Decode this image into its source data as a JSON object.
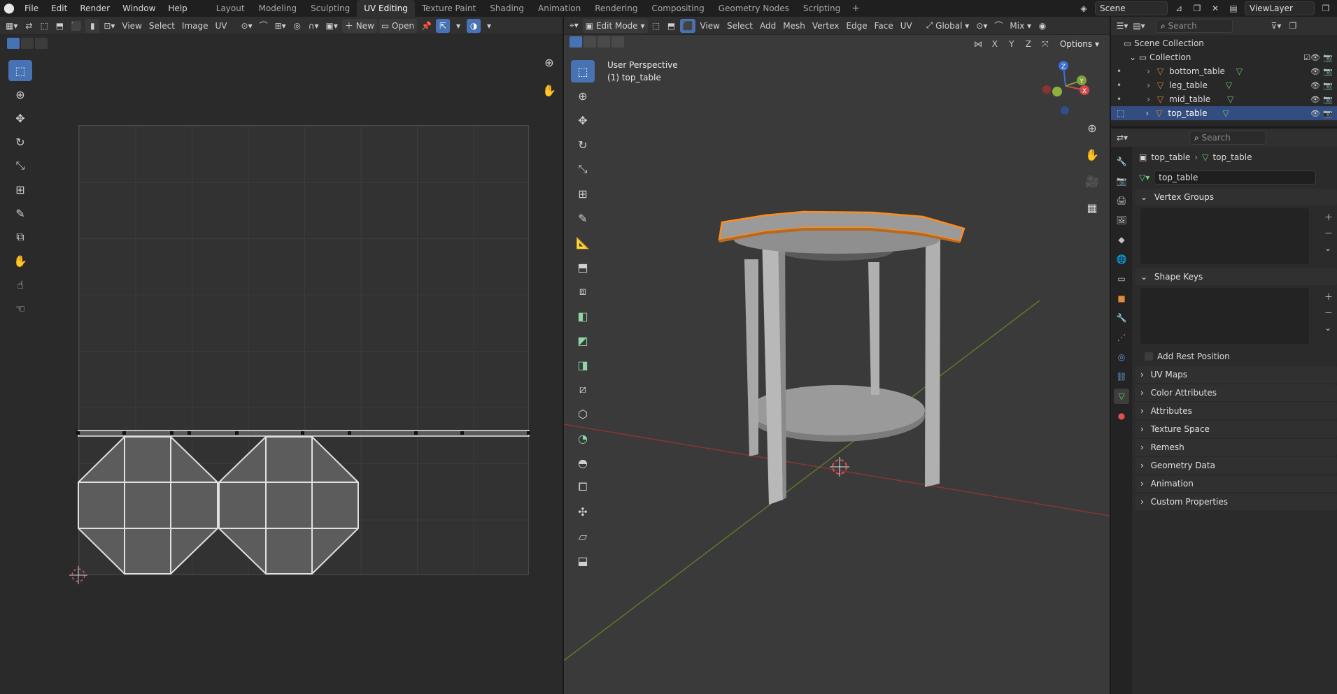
{
  "topbar": {
    "menus": [
      "File",
      "Edit",
      "Render",
      "Window",
      "Help"
    ],
    "workspaces": [
      "Layout",
      "Modeling",
      "Sculpting",
      "UV Editing",
      "Texture Paint",
      "Shading",
      "Animation",
      "Rendering",
      "Compositing",
      "Geometry Nodes",
      "Scripting"
    ],
    "active_workspace": "UV Editing",
    "add_workspace": "+",
    "scene": "Scene",
    "view_layer": "ViewLayer"
  },
  "uv_editor": {
    "menus": [
      "View",
      "Select",
      "Image",
      "UV"
    ],
    "new_label": "New",
    "open_label": "Open"
  },
  "viewport": {
    "mode": "Edit Mode",
    "menus": [
      "View",
      "Select",
      "Add",
      "Mesh",
      "Vertex",
      "Edge",
      "Face",
      "UV"
    ],
    "orientation": "Global",
    "shading": "Mix",
    "options_label": "Options",
    "axes": [
      "X",
      "Y",
      "Z"
    ],
    "perspective": "User Perspective",
    "object_label": "(1) top_table"
  },
  "outliner": {
    "search_placeholder": "Search",
    "scene_collection": "Scene Collection",
    "collection": "Collection",
    "objects": [
      "bottom_table",
      "leg_table",
      "mid_table",
      "top_table"
    ],
    "selected": "top_table"
  },
  "properties": {
    "search_placeholder": "Search",
    "breadcrumb_object": "top_table",
    "breadcrumb_mesh": "top_table",
    "mesh_name": "top_table",
    "panels_open": [
      "Vertex Groups",
      "Shape Keys"
    ],
    "add_rest_position": "Add Rest Position",
    "panels_closed": [
      "UV Maps",
      "Color Attributes",
      "Attributes",
      "Texture Space",
      "Remesh",
      "Geometry Data",
      "Animation",
      "Custom Properties"
    ]
  },
  "colors": {
    "accent": "#4772b3",
    "selection_orange": "#ff8c1a",
    "outliner_selected": "#334d80",
    "axis_red": "#b23a3a",
    "axis_green": "#7fa33a"
  }
}
